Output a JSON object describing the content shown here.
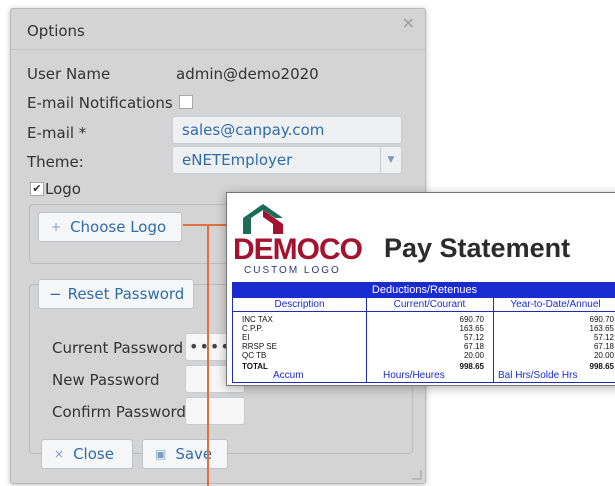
{
  "dialog": {
    "title": "Options",
    "close_glyph": "×",
    "username_label": "User Name",
    "username_value": "admin@demo2020",
    "notifications_label": "E-mail Notifications",
    "email_label": "E-mail *",
    "email_value": "sales@canpay.com",
    "theme_label": "Theme:",
    "theme_value": "eNETEmployer",
    "theme_arrow": "▼",
    "logo_label": "Logo",
    "logo_check_glyph": "✔",
    "choose_logo_icon": "+",
    "choose_logo_label": "Choose Logo",
    "reset_icon": "−",
    "reset_label": "Reset Password",
    "current_pw_label": "Current Password",
    "current_pw_dots": "•••••",
    "new_pw_label": "New Password",
    "confirm_pw_label": "Confirm Password",
    "close_icon": "×",
    "close_label": "Close",
    "save_icon": "▣",
    "save_label": "Save"
  },
  "statement": {
    "logo_name": "DEMOCO",
    "logo_sub": "CUSTOM LOGO",
    "title": "Pay Statement",
    "table_title": "Deductions/Retenues",
    "col_desc": "Description",
    "col_current": "Current/Courant",
    "col_ytd": "Year-to-Date/Annuel",
    "rows": [
      {
        "desc": "INC TAX",
        "current": "690.70",
        "ytd": "690.70"
      },
      {
        "desc": "C.P.P.",
        "current": "163.65",
        "ytd": "163.65"
      },
      {
        "desc": "EI",
        "current": "57.12",
        "ytd": "57.12"
      },
      {
        "desc": "RRSP SE",
        "current": "67.18",
        "ytd": "67.18"
      },
      {
        "desc": "QC TB",
        "current": "20.00",
        "ytd": "20.00"
      }
    ],
    "total_label": "TOTAL",
    "total_current": "998.65",
    "total_ytd": "998.65",
    "foot_accum": "Accum",
    "foot_hours": "Hours/Heures",
    "foot_bal": "Bal Hrs/Solde Hrs"
  },
  "colors": {
    "dialog_bg": "#d4d4d4",
    "accent_blue": "#2e6ba8",
    "connector": "#e07040",
    "table_blue": "#1b2bd2",
    "logo_red": "#a3122e",
    "logo_green": "#1f6b5a"
  }
}
